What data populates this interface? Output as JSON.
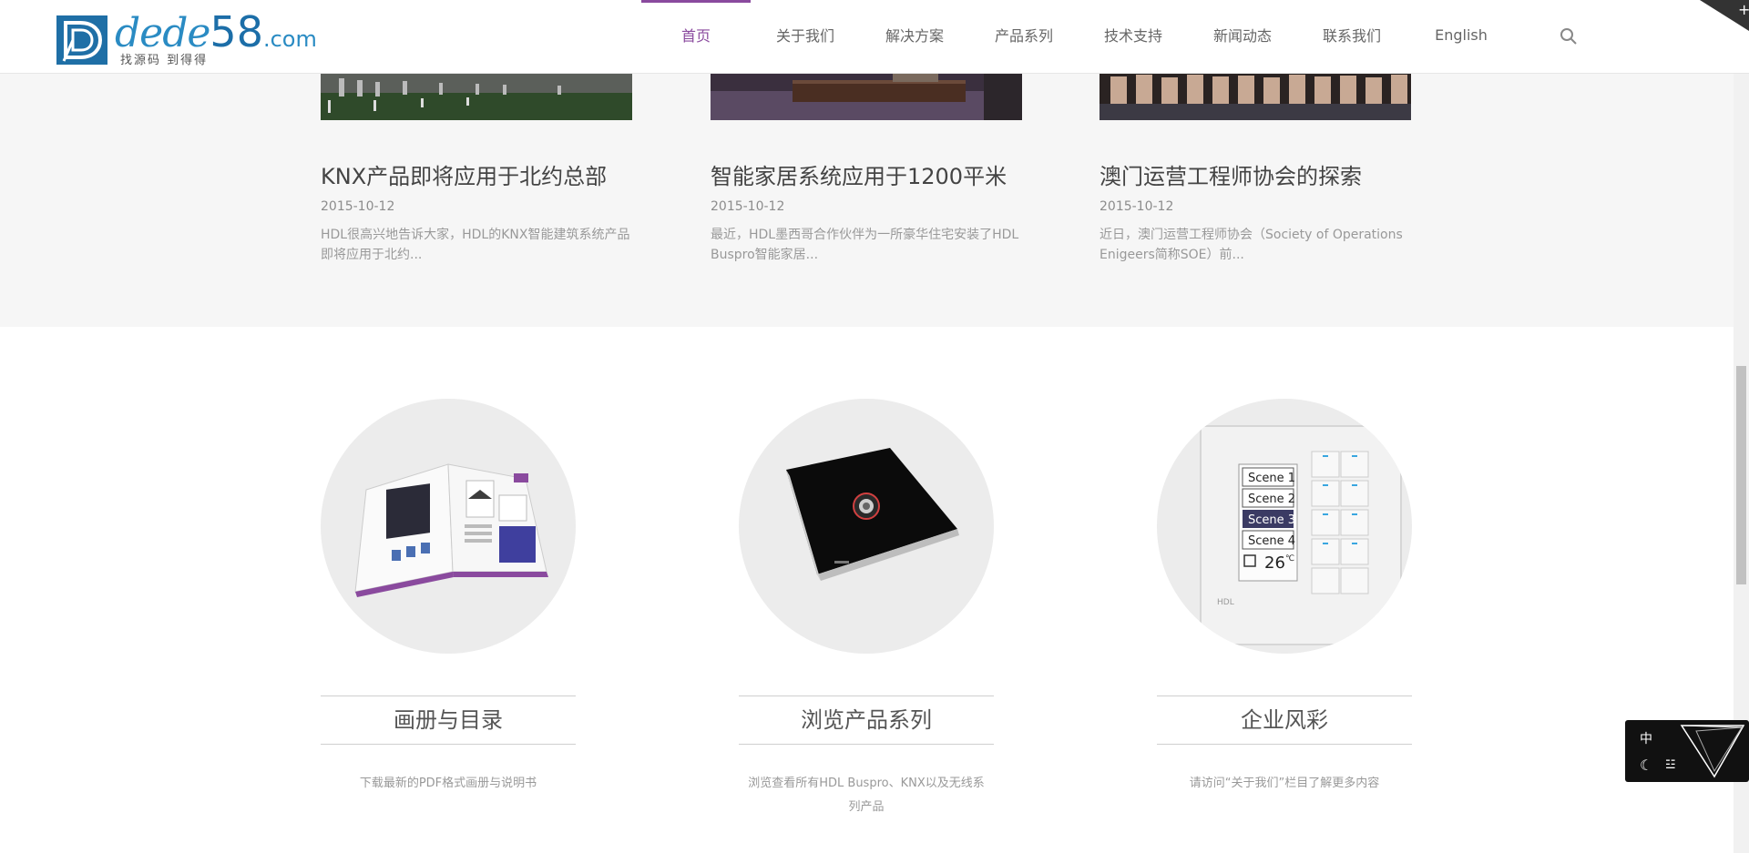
{
  "logo": {
    "word": "dede",
    "number": "58",
    "domain": ".com",
    "tagline": "找源码 到得得",
    "icon": "dede58-logo-icon"
  },
  "nav": {
    "items": [
      {
        "label": "首页",
        "active": true
      },
      {
        "label": "关于我们"
      },
      {
        "label": "解决方案"
      },
      {
        "label": "产品系列"
      },
      {
        "label": "技术支持"
      },
      {
        "label": "新闻动态"
      },
      {
        "label": "联系我们"
      },
      {
        "label": "English"
      }
    ],
    "search_icon": "search-icon",
    "accent_color": "#8a4a9e"
  },
  "news": [
    {
      "title": "KNX产品即将应用于北约总部",
      "date": "2015-10-12",
      "excerpt": "HDL很高兴地告诉大家，HDL的KNX智能建筑系统产品即将应用于北约..."
    },
    {
      "title": "智能家居系统应用于1200平米",
      "date": "2015-10-12",
      "excerpt": "最近，HDL墨西哥合作伙伴为一所豪华住宅安装了HDL Buspro智能家居..."
    },
    {
      "title": "澳门运营工程师协会的探索",
      "date": "2015-10-12",
      "excerpt": "近日，澳门运营工程师协会（Society of Operations Enigeers简称SOE）前..."
    }
  ],
  "features": [
    {
      "title": "画册与目录",
      "desc": "下载最新的PDF格式画册与说明书",
      "image": "brochure-image"
    },
    {
      "title": "浏览产品系列",
      "desc": "浏览查看所有HDL Buspro、KNX以及无线系列产品",
      "image": "smart-switch-panel-image"
    },
    {
      "title": "企业风彩",
      "desc": "请访问“关于我们”栏目了解更多内容",
      "image": "scene-control-panel-image",
      "panel": {
        "scenes": [
          "Scene 1",
          "Scene 2",
          "Scene 3",
          "Scene 4"
        ],
        "temperature": "26",
        "unit": "℃",
        "brand": "HDL"
      }
    }
  ],
  "widget": {
    "lang": "中",
    "moon_icon": "moon-icon",
    "shirt_icon": "shirt-icon",
    "logo_icon": "triangle-logo-icon"
  },
  "corner": {
    "plus": "+"
  }
}
